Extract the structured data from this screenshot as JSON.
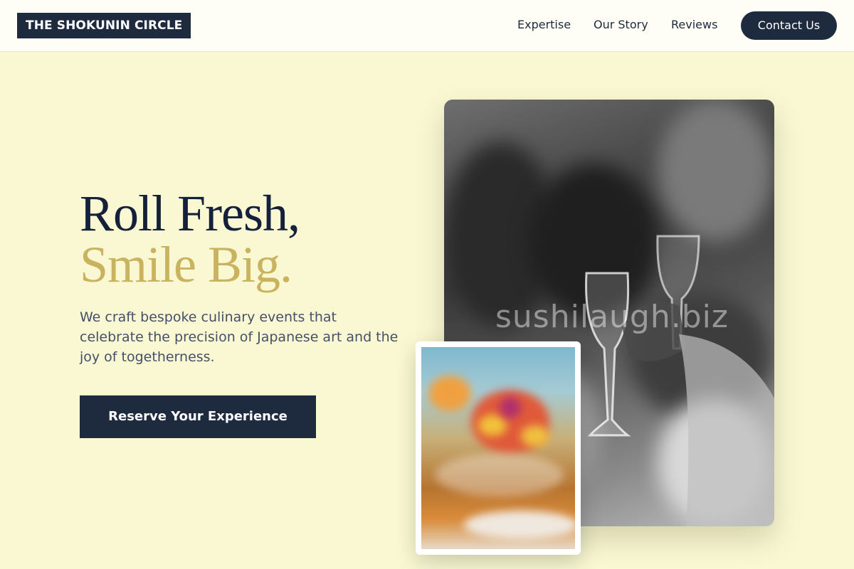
{
  "header": {
    "logo_text": "THE SHOKUNIN CIRCLE",
    "nav": [
      "Expertise",
      "Our Story",
      "Reviews"
    ],
    "contact_label": "Contact Us"
  },
  "hero": {
    "headline_line1": "Roll Fresh,",
    "headline_line2": "Smile Big.",
    "description": "We craft bespoke culinary events that celebrate the precision of Japanese art and the joy of togetherness.",
    "cta_label": "Reserve Your Experience"
  },
  "images": {
    "main_photo": "black-and-white photo of guests toasting with wine glasses",
    "main_photo_watermark": "sushilaugh.biz",
    "small_photo": "colorful table setting with flowers and wine glasses"
  },
  "colors": {
    "background": "#f9f8d2",
    "navy": "#1e2a3e",
    "gold": "#c9b35f"
  }
}
